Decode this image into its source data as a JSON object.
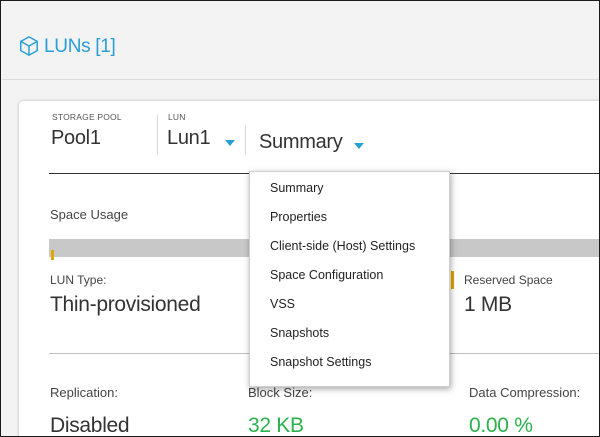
{
  "header": {
    "title": "LUNs [1]"
  },
  "selectors": {
    "storage_pool": {
      "label": "STORAGE POOL",
      "value": "Pool1"
    },
    "lun": {
      "label": "LUN",
      "value": "Lun1"
    },
    "view": {
      "value": "Summary"
    }
  },
  "dropdown": {
    "items": [
      "Summary",
      "Properties",
      "Client-side (Host) Settings",
      "Space Configuration",
      "VSS",
      "Snapshots",
      "Snapshot Settings"
    ]
  },
  "summary": {
    "space_usage_label": "Space Usage",
    "lun_type": {
      "label": "LUN Type:",
      "value": "Thin-provisioned"
    },
    "reserved_space": {
      "label": "Reserved Space",
      "value": "1 MB"
    },
    "replication": {
      "label": "Replication:",
      "value": "Disabled"
    },
    "block_size": {
      "label": "Block Size:",
      "value": "32 KB"
    },
    "data_compression": {
      "label": "Data Compression:",
      "value": "0.00 %"
    }
  },
  "colors": {
    "accent": "#2a9fd6",
    "value_green": "#2bb24c",
    "reserved_marker": "#e3a600",
    "usage_bar": "#c8c8c8"
  },
  "icons": {
    "header": "cube-icon",
    "dropdown": "chevron-down-icon"
  }
}
